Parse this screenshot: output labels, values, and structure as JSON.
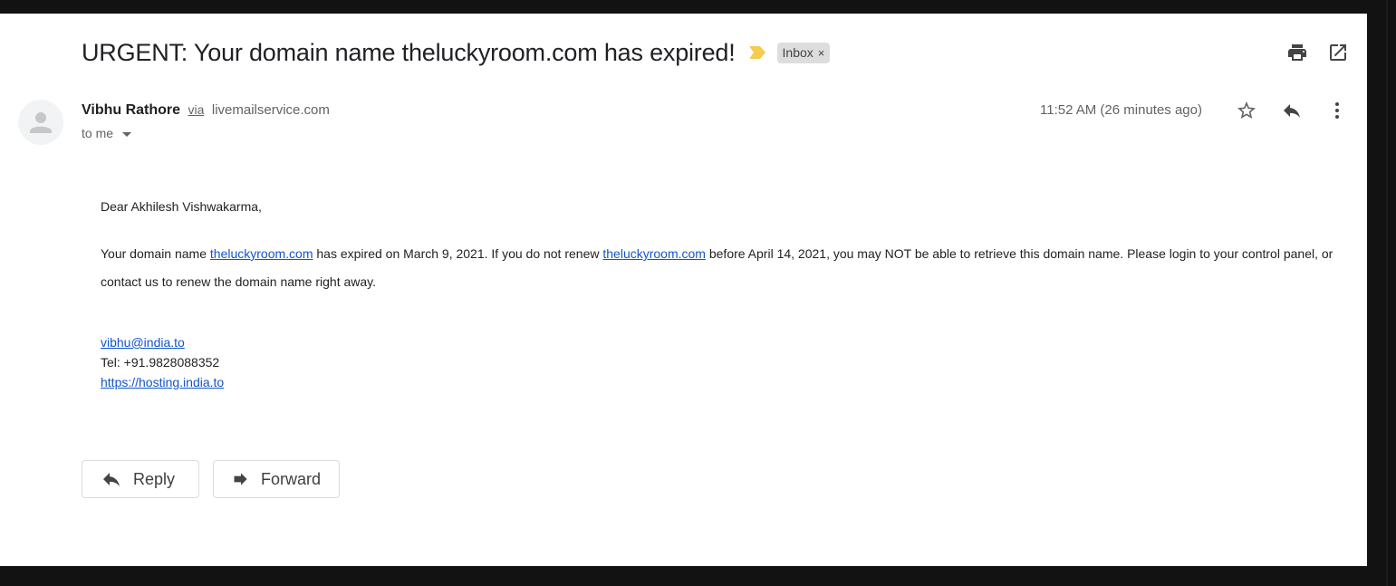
{
  "email": {
    "subject": "URGENT: Your domain name theluckyroom.com has expired!",
    "label": "Inbox",
    "label_remove": "×",
    "sender_name": "Vibhu Rathore",
    "via": "via",
    "sender_domain": "livemailservice.com",
    "recipient": "to me",
    "timestamp": "11:52 AM (26 minutes ago)"
  },
  "body": {
    "greeting": "Dear Akhilesh Vishwakarma,",
    "p1_a": "Your domain name ",
    "link_domain": "theluckyroom.com",
    "p1_b": " has expired on March 9, 2021. If you do not renew ",
    "p1_c": " before April 14, 2021, you may NOT be able to retrieve this domain name. Please login to your control panel, or contact us to renew the domain name right away.",
    "sig_email": "vibhu@india.to",
    "sig_tel": "Tel: +91.9828088352",
    "sig_url": "https://hosting.india.to"
  },
  "actions": {
    "reply": "Reply",
    "forward": "Forward"
  },
  "colors": {
    "background_dark": "#121212",
    "panel": "#ffffff",
    "link": "#1155cc",
    "importance_marker": "#f7cb4d",
    "chip": "#dddddd"
  },
  "icons": [
    "importance-marker-icon",
    "print-icon",
    "open-in-new-window-icon",
    "avatar-person-icon",
    "dropdown-caret-icon",
    "star-icon",
    "reply-icon",
    "more-options-icon",
    "reply-arrow-icon",
    "forward-arrow-icon"
  ]
}
